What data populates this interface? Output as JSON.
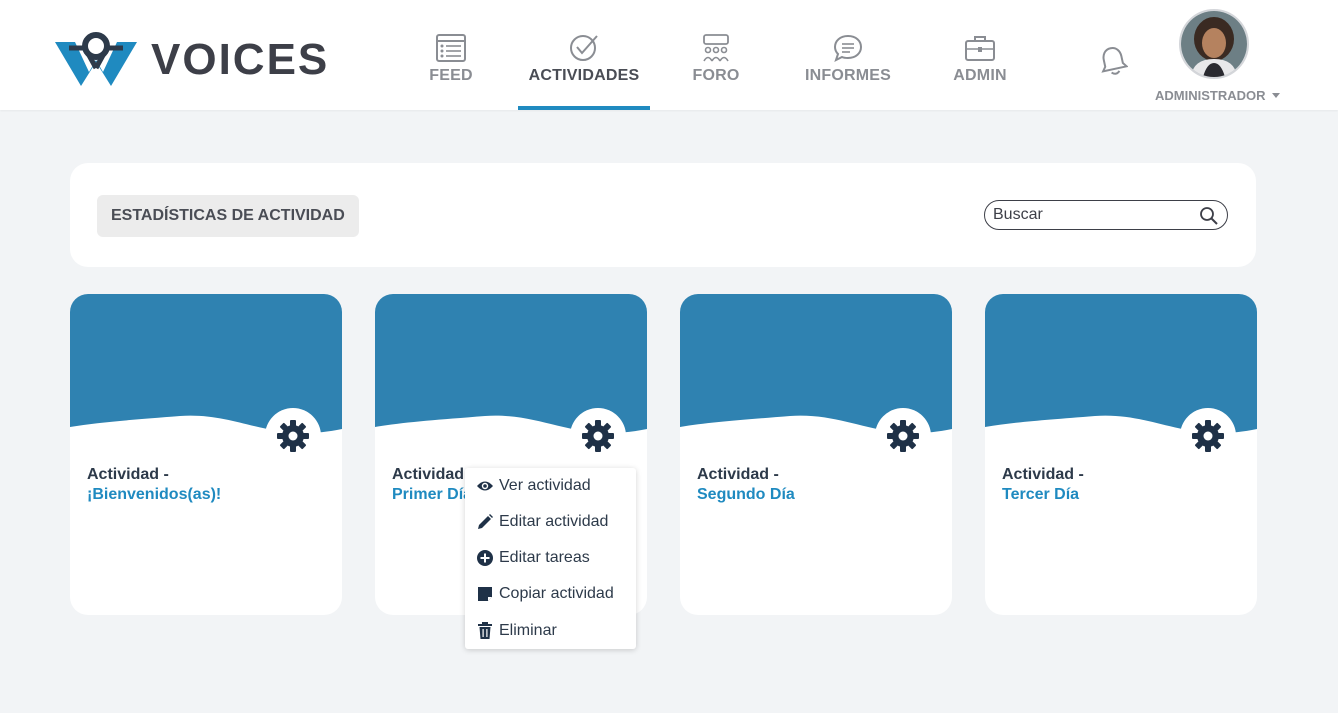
{
  "header": {
    "brand": "VOICES",
    "nav": [
      {
        "label": "FEED",
        "icon": "feed-icon"
      },
      {
        "label": "ACTIVIDADES",
        "icon": "check-circle-icon",
        "active": true
      },
      {
        "label": "FORO",
        "icon": "forum-icon"
      },
      {
        "label": "INFORMES",
        "icon": "chat-bubble-icon"
      },
      {
        "label": "ADMIN",
        "icon": "briefcase-icon"
      }
    ],
    "user_role": "ADMINISTRADOR"
  },
  "stats": {
    "button_label": "ESTADÍSTICAS DE ACTIVIDAD",
    "search_placeholder": "Buscar"
  },
  "cards": [
    {
      "title": "Actividad -",
      "name": "¡Bienvenidos(as)!"
    },
    {
      "title": "Actividad -",
      "name": "Primer Día"
    },
    {
      "title": "Actividad -",
      "name": "Segundo Día"
    },
    {
      "title": "Actividad -",
      "name": "Tercer Día"
    }
  ],
  "menu": {
    "items": [
      {
        "label": "Ver actividad",
        "icon": "eye-icon"
      },
      {
        "label": "Editar actividad",
        "icon": "pencil-icon"
      },
      {
        "label": "Editar tareas",
        "icon": "plus-circle-icon"
      },
      {
        "label": "Copiar actividad",
        "icon": "copy-icon"
      },
      {
        "label": "Eliminar",
        "icon": "trash-icon"
      }
    ]
  },
  "colors": {
    "brand_blue": "#1f8ac0",
    "card_header": "#2f82b1",
    "dark_text": "#2d3a4a",
    "icon_dark": "#1f3147"
  }
}
